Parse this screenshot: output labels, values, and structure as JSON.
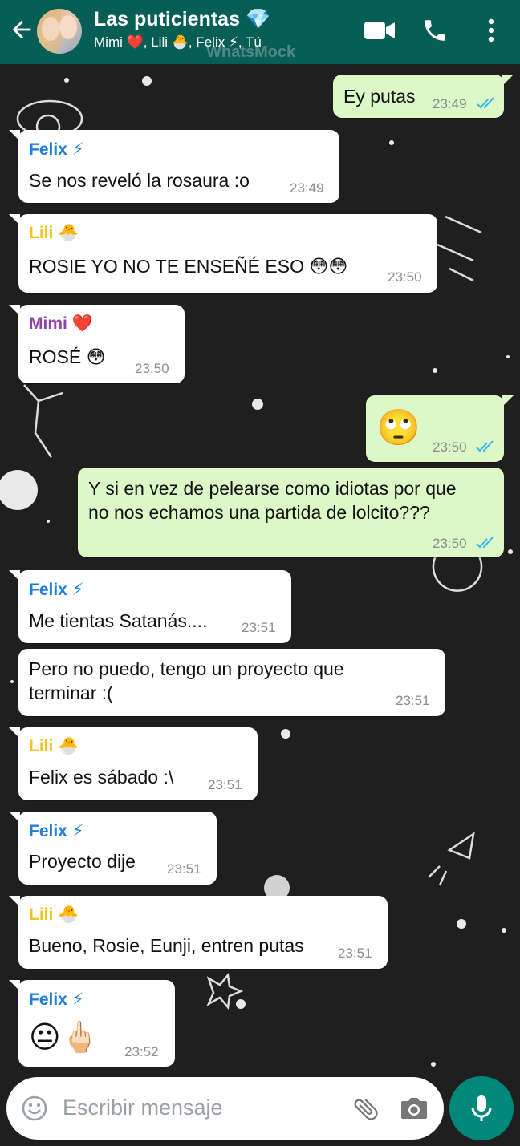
{
  "header": {
    "title": "Las puticientas 💎",
    "subtitle": "Mimi ❤️, Lili 🐣, Felix ⚡, Tú",
    "watermark": "WhatsMock"
  },
  "colors": {
    "header_bg": "#075e54",
    "incoming_bg": "#ffffff",
    "outgoing_bg": "#dcf8c6",
    "felix": "#1f7fd6",
    "lili": "#f0c419",
    "mimi": "#8e44ad",
    "read_ticks": "#34b7f1",
    "mic_button": "#00897b"
  },
  "messages": [
    {
      "sender": "",
      "text": "Ey putas",
      "time": "23:49"
    },
    {
      "sender": "Felix ⚡",
      "text": "Se nos reveló la rosaura :o",
      "time": "23:49"
    },
    {
      "sender": "Lili 🐣",
      "text": "ROSIE YO NO TE ENSEÑÉ ESO 😳😳",
      "time": "23:50"
    },
    {
      "sender": "Mimi ❤️",
      "text": "ROSÉ 😳",
      "time": "23:50"
    },
    {
      "sender": "",
      "text": "🙄",
      "time": "23:50"
    },
    {
      "sender": "",
      "text_line1": "Y si en vez de pelearse como idiotas por que",
      "text_line2": "no nos echamos una partida de lolcito???",
      "time": "23:50"
    },
    {
      "sender": "Felix ⚡",
      "text": "Me tientas Satanás....",
      "time": "23:51"
    },
    {
      "sender": "",
      "text_line1": "Pero no puedo, tengo un proyecto que",
      "text_line2": "terminar :(",
      "time": "23:51"
    },
    {
      "sender": "Lili 🐣",
      "text": "Felix es sábado :\\",
      "time": "23:51"
    },
    {
      "sender": "Felix ⚡",
      "text": "Proyecto dije",
      "time": "23:51"
    },
    {
      "sender": "Lili 🐣",
      "text": "Bueno, Rosie, Eunji, entren putas",
      "time": "23:51"
    },
    {
      "sender": "Felix ⚡",
      "text": "😐🖕🏻",
      "time": "23:52"
    }
  ],
  "input": {
    "placeholder": "Escribir mensaje"
  },
  "icons": [
    "back-arrow-icon",
    "group-avatar",
    "video-call-icon",
    "phone-icon",
    "more-options-icon",
    "emoji-icon",
    "attach-icon",
    "camera-icon",
    "mic-icon",
    "read-ticks-icon"
  ]
}
